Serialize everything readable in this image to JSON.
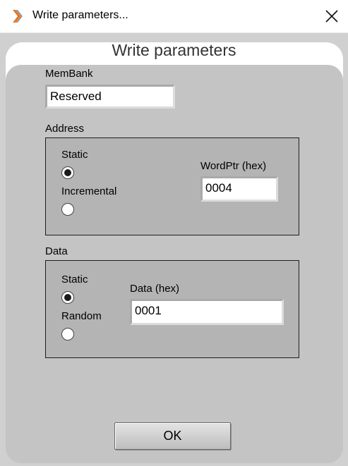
{
  "window": {
    "title": "Write parameters..."
  },
  "dialog": {
    "title": "Write parameters"
  },
  "membank": {
    "label": "MemBank",
    "value": "Reserved"
  },
  "address": {
    "label": "Address",
    "static_label": "Static",
    "incremental_label": "Incremental",
    "selected": "static",
    "wordptr_label": "WordPtr (hex)",
    "wordptr_value": "0004"
  },
  "data": {
    "label": "Data",
    "static_label": "Static",
    "random_label": "Random",
    "selected": "static",
    "hex_label": "Data (hex)",
    "hex_value": "0001"
  },
  "ok_label": "OK",
  "icons": {
    "app": "app-icon",
    "close": "close-icon"
  },
  "colors": {
    "frame": "#d0d0d0",
    "panel": "#c4c4c4",
    "group": "#b4b4b4",
    "app_icon": "#e87722"
  }
}
